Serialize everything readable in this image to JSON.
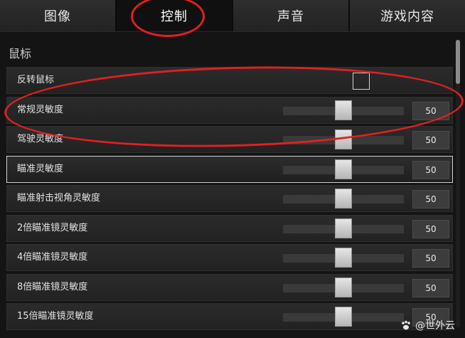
{
  "tabs": [
    {
      "label": "图像",
      "active": false
    },
    {
      "label": "控制",
      "active": true
    },
    {
      "label": "声音",
      "active": false
    },
    {
      "label": "游戏内容",
      "active": false
    }
  ],
  "section": {
    "title": "鼠标"
  },
  "rows": [
    {
      "label": "反转鼠标",
      "type": "checkbox",
      "checked": false
    },
    {
      "label": "常规灵敏度",
      "type": "slider",
      "value": "50",
      "fraction": 0.5
    },
    {
      "label": "驾驶灵敏度",
      "type": "slider",
      "value": "50",
      "fraction": 0.5
    },
    {
      "label": "瞄准灵敏度",
      "type": "slider",
      "value": "50",
      "fraction": 0.5,
      "highlight": true
    },
    {
      "label": "瞄准射击视角灵敏度",
      "type": "slider",
      "value": "50",
      "fraction": 0.5
    },
    {
      "label": "2倍瞄准镜灵敏度",
      "type": "slider",
      "value": "50",
      "fraction": 0.5
    },
    {
      "label": "4倍瞄准镜灵敏度",
      "type": "slider",
      "value": "50",
      "fraction": 0.5
    },
    {
      "label": "8倍瞄准镜灵敏度",
      "type": "slider",
      "value": "50",
      "fraction": 0.5
    },
    {
      "label": "15倍瞄准镜灵敏度",
      "type": "slider",
      "value": "50",
      "fraction": 0.5
    }
  ],
  "watermark": {
    "text": "@世外云",
    "icon": "paw-icon"
  },
  "colors": {
    "annotation": "#e02020",
    "background": "#141414"
  }
}
